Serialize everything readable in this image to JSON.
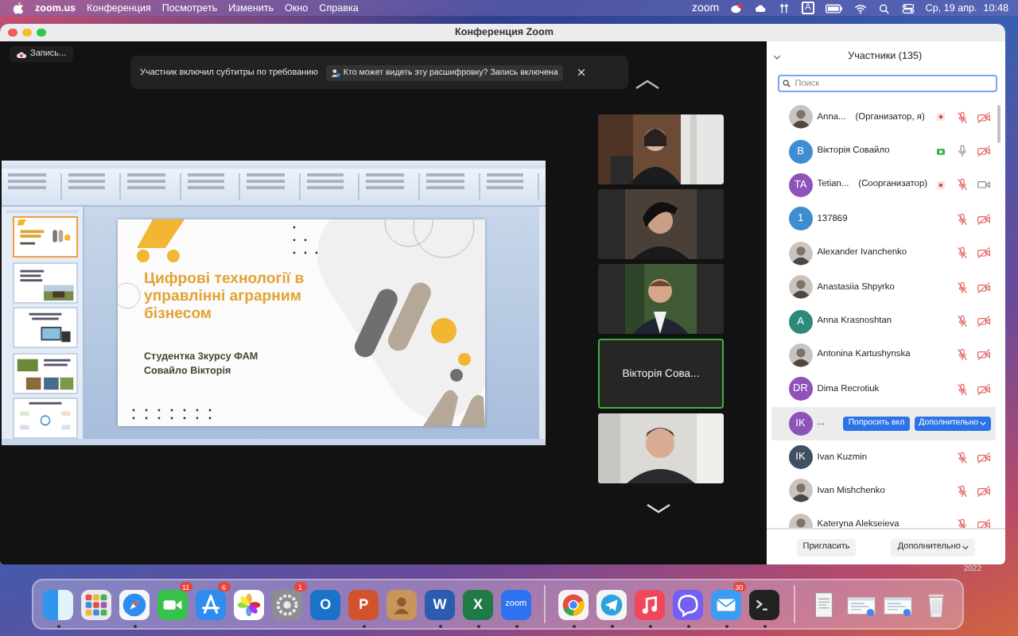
{
  "menu_bar": {
    "app": "zoom.us",
    "menus": [
      "Конференция",
      "Посмотреть",
      "Изменить",
      "Окно",
      "Справка"
    ],
    "status_app": "zoom",
    "input_source": "A",
    "date": "Ср, 19 апр.",
    "time": "10:48"
  },
  "window": {
    "title": "Конференция Zoom"
  },
  "meeting": {
    "recording_label": "Запись...",
    "notice": {
      "text": "Участник включил субтитры по требованию",
      "link": "Кто может видеть эту расшифровку? Запись включена"
    },
    "slide": {
      "title": "Цифрові технології в управлінні аграрним бізнесом",
      "lines": [
        "Студентка 3курсу ФАМ",
        "Совайло Вікторія"
      ]
    },
    "thumbnails": [
      {
        "selected": true
      },
      {
        "selected": false
      },
      {
        "selected": false
      },
      {
        "selected": false
      },
      {
        "selected": false
      }
    ],
    "video_tiles": [
      {
        "kind": "video",
        "selected": false
      },
      {
        "kind": "video",
        "selected": false
      },
      {
        "kind": "video",
        "selected": false
      },
      {
        "kind": "name",
        "name": "Вікторія Сова...",
        "selected": true
      },
      {
        "kind": "video",
        "selected": false
      }
    ]
  },
  "participants": {
    "title": "Участники (135)",
    "search_placeholder": "Поиск",
    "rows": [
      {
        "kind": "normal",
        "name": "Anna...",
        "role": "(Организатор, я)",
        "recording": true,
        "sharing": false,
        "mic_muted": true,
        "video_on": false
      },
      {
        "kind": "normal",
        "name": "Вікторія Совайло",
        "avatar": {
          "kind": "initials",
          "text": "B",
          "color": "#3d8ed0"
        },
        "recording": false,
        "sharing": true,
        "mic_muted": false,
        "video_on": false
      },
      {
        "kind": "normal",
        "name": "Tetian...",
        "role": "(Соорганизатор)",
        "avatar": {
          "kind": "initials",
          "text": "TA",
          "color": "#8e52b8"
        },
        "recording": true,
        "sharing": false,
        "mic_muted": true,
        "video_on": true
      },
      {
        "kind": "normal",
        "name": "137869",
        "avatar": {
          "kind": "initials",
          "text": "1",
          "color": "#3d8ed0"
        },
        "recording": false,
        "sharing": false,
        "mic_muted": true,
        "video_on": false
      },
      {
        "kind": "normal",
        "name": "Alexander Ivanchenko",
        "recording": false,
        "sharing": false,
        "mic_muted": true,
        "video_on": false
      },
      {
        "kind": "normal",
        "name": "Anastasiia Shpyrko",
        "recording": false,
        "sharing": false,
        "mic_muted": true,
        "video_on": false
      },
      {
        "kind": "normal",
        "name": "Anna Krasnoshtan",
        "avatar": {
          "kind": "initials",
          "text": "A",
          "color": "#2e8a78"
        },
        "recording": false,
        "sharing": false,
        "mic_muted": true,
        "video_on": false
      },
      {
        "kind": "normal",
        "name": "Antonina Kartushynska",
        "recording": false,
        "sharing": false,
        "mic_muted": true,
        "video_on": false
      },
      {
        "kind": "normal",
        "name": "Dima Recrotiuk",
        "avatar": {
          "kind": "initials",
          "text": "DR",
          "color": "#8e52b8"
        },
        "recording": false,
        "sharing": false,
        "mic_muted": true,
        "video_on": false
      },
      {
        "kind": "hover",
        "name": "...",
        "avatar": {
          "kind": "initials",
          "text": "IK",
          "color": "#8e52b8"
        },
        "actions": [
          "Попросить вкл",
          "Дополнительно"
        ]
      },
      {
        "kind": "normal",
        "name": "Ivan Kuzmin",
        "avatar": {
          "kind": "initials",
          "text": "IK",
          "color": "#3f5062"
        },
        "recording": false,
        "sharing": false,
        "mic_muted": true,
        "video_on": false
      },
      {
        "kind": "normal",
        "name": "Ivan Mishchenko",
        "recording": false,
        "sharing": false,
        "mic_muted": true,
        "video_on": false
      },
      {
        "kind": "normal",
        "name": "Kateryna Alekseieva",
        "recording": false,
        "sharing": false,
        "mic_muted": true,
        "video_on": false
      }
    ],
    "footer_buttons": [
      "Пригласить",
      "Дополнительно"
    ]
  },
  "desktop_label": "2022",
  "dock": {
    "items": [
      {
        "kind": "finder",
        "running": true
      },
      {
        "kind": "launchpad",
        "running": false
      },
      {
        "kind": "safari",
        "running": true
      },
      {
        "kind": "facetime",
        "running": false,
        "badge": "11"
      },
      {
        "kind": "appstore",
        "running": false,
        "badge": "6"
      },
      {
        "kind": "photos",
        "running": false
      },
      {
        "kind": "settings",
        "running": false,
        "badge": "1"
      },
      {
        "kind": "letter",
        "glyph": "O",
        "color": "#1a73c8",
        "running": false
      },
      {
        "kind": "letter",
        "glyph": "P",
        "color": "#d2522c",
        "running": true
      },
      {
        "kind": "contacts",
        "running": false
      },
      {
        "kind": "letter",
        "glyph": "W",
        "color": "#2b5cb0",
        "running": true
      },
      {
        "kind": "letter",
        "glyph": "X",
        "color": "#1f7a45",
        "running": true
      },
      {
        "kind": "letter",
        "glyph": "zoom",
        "color": "#2d72f0",
        "running": true
      },
      {
        "kind": "separator"
      },
      {
        "kind": "chrome",
        "running": true
      },
      {
        "kind": "telegram",
        "running": true
      },
      {
        "kind": "music",
        "running": true
      },
      {
        "kind": "viber",
        "running": true
      },
      {
        "kind": "mail",
        "running": true,
        "badge": "30"
      },
      {
        "kind": "terminal",
        "running": true
      },
      {
        "kind": "separator"
      },
      {
        "kind": "document"
      },
      {
        "kind": "window"
      },
      {
        "kind": "window"
      },
      {
        "kind": "trash"
      }
    ]
  }
}
